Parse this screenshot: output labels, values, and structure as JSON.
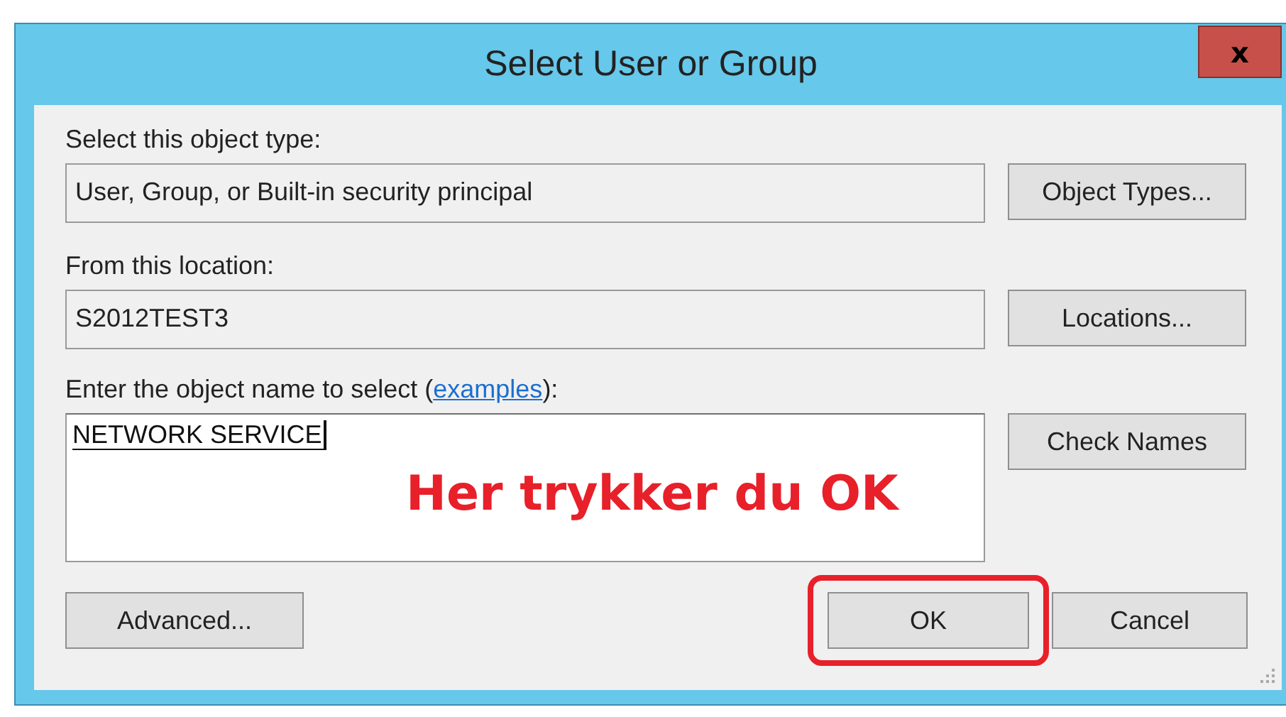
{
  "window": {
    "title": "Select User or Group",
    "close_glyph": "x"
  },
  "object_type": {
    "label": "Select this object type:",
    "value": "User, Group, or Built-in security principal",
    "button": "Object Types..."
  },
  "location": {
    "label": "From this location:",
    "value": "S2012TEST3",
    "button": "Locations..."
  },
  "object_name": {
    "label_before": "Enter the object name to select (",
    "link": "examples",
    "label_after": "):",
    "value": "NETWORK SERVICE",
    "button": "Check Names"
  },
  "annotation": {
    "text": "Her trykker du OK",
    "color": "#e8202a"
  },
  "buttons": [
    {
      "label": "Advanced...",
      "highlighted": false
    },
    {
      "label": "OK",
      "highlighted": true
    },
    {
      "label": "Cancel",
      "highlighted": false
    }
  ]
}
